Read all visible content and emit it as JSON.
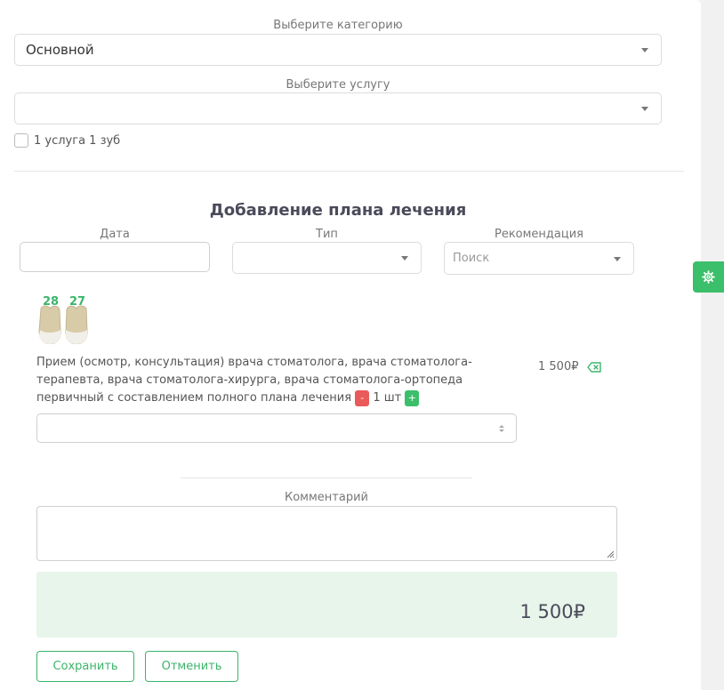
{
  "category": {
    "label": "Выберите категорию",
    "value": "Основной"
  },
  "service": {
    "label": "Выберите услугу",
    "value": ""
  },
  "one_per_tooth": {
    "label": "1 услуга 1 зуб",
    "checked": false
  },
  "plan": {
    "title": "Добавление плана лечения",
    "date_label": "Дата",
    "type_label": "Тип",
    "recommendation_label": "Рекомендация",
    "recommendation_placeholder": "Поиск"
  },
  "teeth": [
    "28",
    "27"
  ],
  "item": {
    "description": "Прием (осмотр, консультация) врача стоматолога, врача стоматолога-терапевта, врача стоматолога-хирурга, врача стоматолога-ортопеда первичный с составлением полного плана лечения",
    "minus": "-",
    "quantity": "1 шт",
    "plus": "+",
    "price": "1 500₽"
  },
  "comment": {
    "label": "Комментарий"
  },
  "total": "1 500₽",
  "actions": {
    "save": "Сохранить",
    "cancel": "Отменить"
  },
  "colors": {
    "accent": "#3bb56a",
    "danger": "#ea5a5a",
    "total_bg": "#e7f5ea"
  }
}
